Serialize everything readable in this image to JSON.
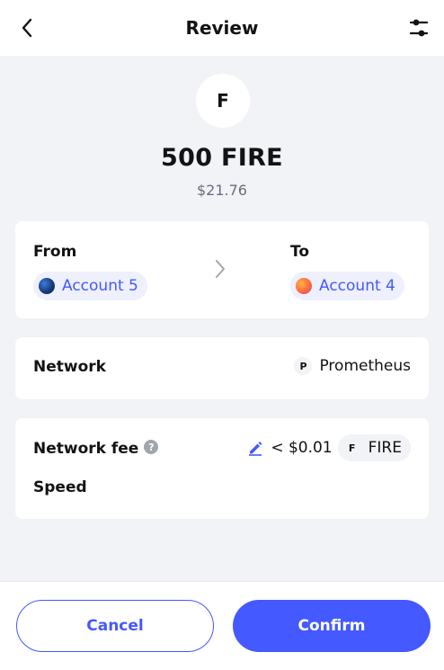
{
  "header": {
    "title": "Review"
  },
  "token": {
    "avatar_letter": "F",
    "amount": "500 FIRE",
    "fiat_value": "$21.76"
  },
  "transfer": {
    "from_label": "From",
    "from_account": "Account 5",
    "to_label": "To",
    "to_account": "Account 4"
  },
  "network": {
    "label": "Network",
    "badge_letter": "P",
    "name": "Prometheus"
  },
  "fee": {
    "label": "Network fee",
    "info_glyph": "?",
    "amount": "< $0.01",
    "token_letter": "F",
    "token_symbol": "FIRE",
    "speed_label": "Speed"
  },
  "actions": {
    "cancel_label": "Cancel",
    "confirm_label": "Confirm"
  },
  "colors": {
    "primary": "#4459ff",
    "background": "#f2f3f6",
    "card": "#ffffff",
    "muted_text": "#686e7d"
  }
}
